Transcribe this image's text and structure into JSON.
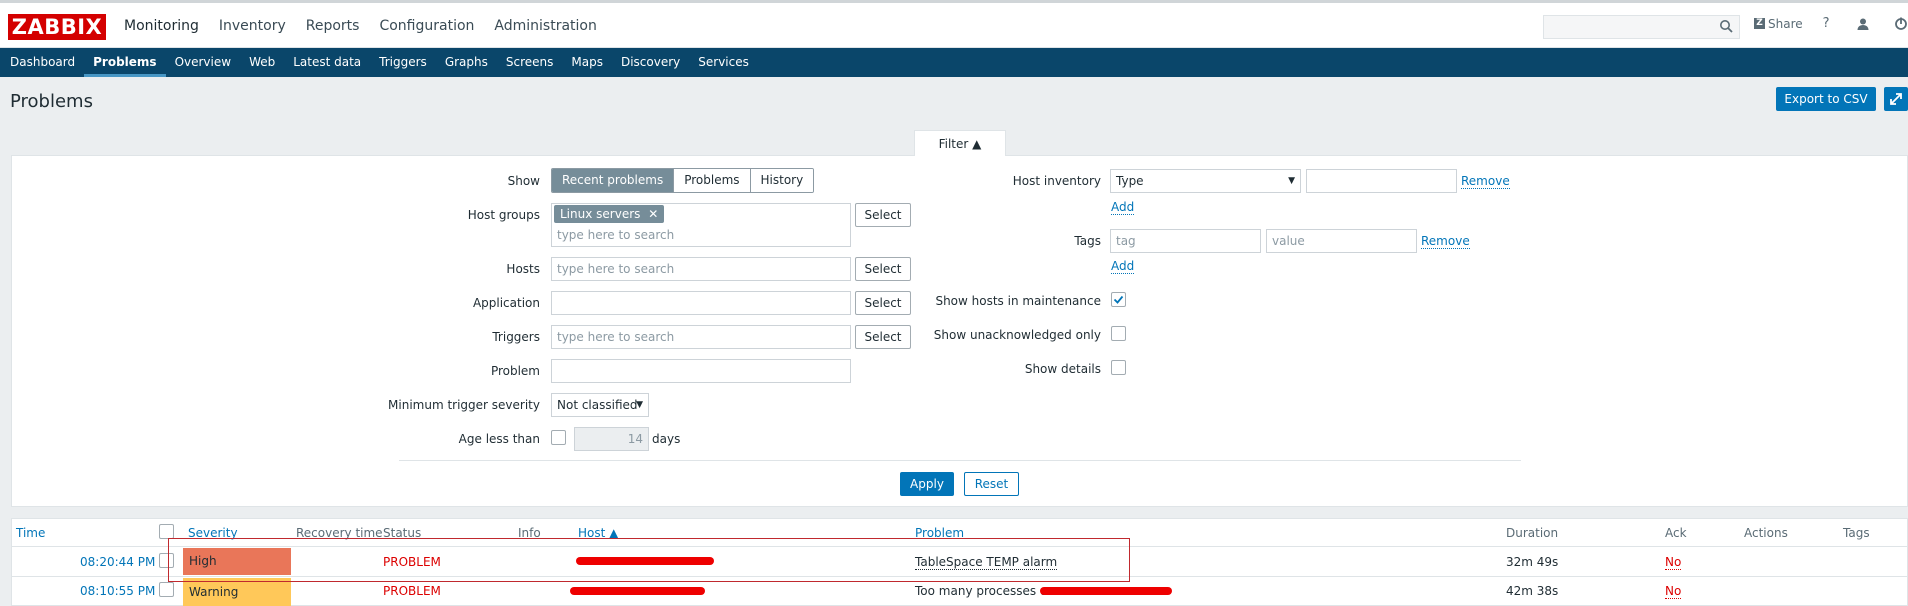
{
  "app": {
    "logo": "ZABBIX"
  },
  "top_menu": [
    "Monitoring",
    "Inventory",
    "Reports",
    "Configuration",
    "Administration"
  ],
  "tools": {
    "share": "Share",
    "help": "?"
  },
  "sub_menu": [
    "Dashboard",
    "Problems",
    "Overview",
    "Web",
    "Latest data",
    "Triggers",
    "Graphs",
    "Screens",
    "Maps",
    "Discovery",
    "Services"
  ],
  "page": {
    "title": "Problems",
    "export_label": "Export to CSV"
  },
  "filter": {
    "tab_label": "Filter ▲",
    "show_label": "Show",
    "show_options": [
      "Recent problems",
      "Problems",
      "History"
    ],
    "host_groups_label": "Host groups",
    "host_group_tag": "Linux servers",
    "search_placeholder": "type here to search",
    "hosts_label": "Hosts",
    "application_label": "Application",
    "triggers_label": "Triggers",
    "problem_label": "Problem",
    "min_severity_label": "Minimum trigger severity",
    "min_severity_value": "Not classified",
    "age_label": "Age less than",
    "age_value": "14",
    "age_unit": "days",
    "select_label": "Select",
    "host_inventory_label": "Host inventory",
    "inventory_type": "Type",
    "remove_label": "Remove",
    "add_label": "Add",
    "tags_label": "Tags",
    "tag_placeholder": "tag",
    "value_placeholder": "value",
    "show_maintenance_label": "Show hosts in maintenance",
    "show_unack_label": "Show unacknowledged only",
    "show_details_label": "Show details",
    "apply_label": "Apply",
    "reset_label": "Reset"
  },
  "table": {
    "headers": {
      "time": "Time",
      "severity": "Severity",
      "recovery_time": "Recovery time",
      "status": "Status",
      "info": "Info",
      "host": "Host ▲",
      "problem": "Problem",
      "duration": "Duration",
      "ack": "Ack",
      "actions": "Actions",
      "tags": "Tags"
    },
    "rows": [
      {
        "time": "08:20:44 PM",
        "severity": "High",
        "status": "PROBLEM",
        "problem": "TableSpace TEMP alarm",
        "duration": "32m 49s",
        "ack": "No"
      },
      {
        "time": "08:10:55 PM",
        "severity": "Warning",
        "status": "PROBLEM",
        "problem": "Too many processes o",
        "duration": "42m 38s",
        "ack": "No"
      }
    ]
  },
  "colors": {
    "brand": "#d40000",
    "nav": "#0a466a",
    "accent": "#0275b8",
    "high": "#e97659",
    "warning": "#ffc859",
    "problem_text": "#dc0000"
  }
}
